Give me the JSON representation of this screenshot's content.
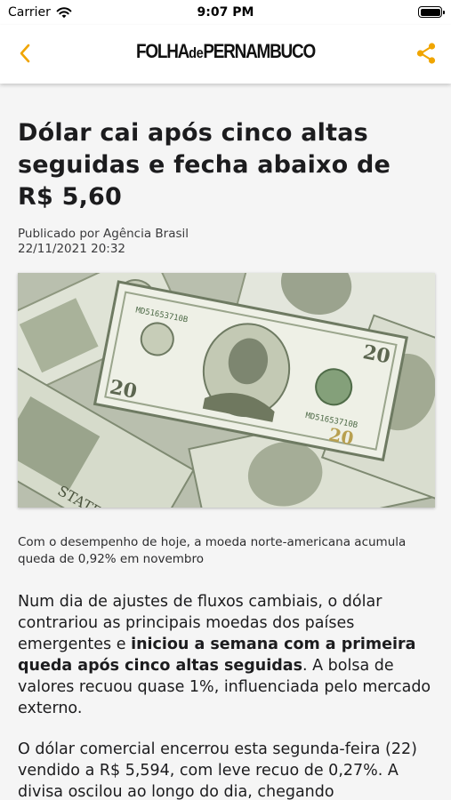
{
  "status_bar": {
    "carrier": "Carrier",
    "time": "9:07 PM"
  },
  "nav": {
    "logo_part1": "FOLHA",
    "logo_part2": "de",
    "logo_part3": "PERNAMBUCO",
    "accent_color": "#f0a500"
  },
  "article": {
    "title": "Dólar cai após cinco altas seguidas e fecha abaixo de R$ 5,60",
    "byline": "Publicado por Agência Brasil",
    "date": "22/11/2021 20:32",
    "image_icon": "dollar-bills-photo",
    "caption": "Com o desempenho de hoje, a moeda norte-americana acumula queda de 0,92% em novembro",
    "paragraph1_a": "Num dia de ajustes de fluxos cambiais, o dólar contrariou as principais moedas dos países emergentes e ",
    "paragraph1_bold": "iniciou a semana com a primeira queda após cinco altas seguidas",
    "paragraph1_b": ". A bolsa de valores recuou quase 1%, influenciada pelo mercado externo.",
    "paragraph2": "O dólar comercial encerrou esta segunda-feira (22) vendido a R$ 5,594, com leve recuo de 0,27%. A divisa oscilou ao longo do dia, chegando"
  }
}
